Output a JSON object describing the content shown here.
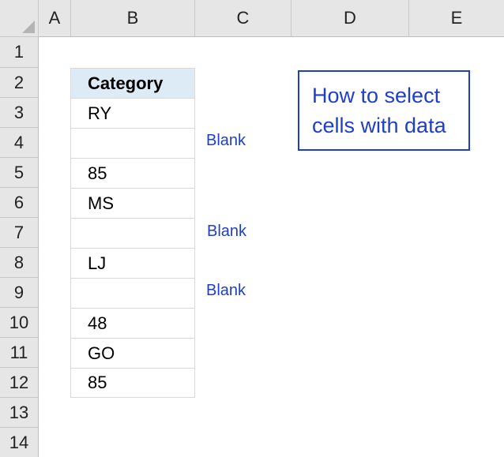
{
  "columns": [
    "A",
    "B",
    "C",
    "D",
    "E"
  ],
  "rows": [
    "1",
    "2",
    "3",
    "4",
    "5",
    "6",
    "7",
    "8",
    "9",
    "10",
    "11",
    "12",
    "13",
    "14"
  ],
  "table": {
    "header": "Category",
    "values": [
      "RY",
      "",
      "85",
      "MS",
      "",
      "LJ",
      "",
      "48",
      "GO",
      "85"
    ]
  },
  "blank_labels": [
    "Blank",
    "Blank",
    "Blank"
  ],
  "note": {
    "line1": "How to select",
    "line2": "cells with data"
  },
  "colors": {
    "header_fill": "#ddebf7",
    "accent_blue": "#1f3fc4",
    "grid_header": "#e6e6e6"
  }
}
